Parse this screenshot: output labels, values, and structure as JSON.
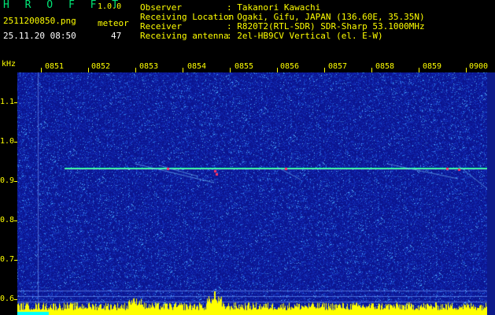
{
  "header": {
    "app_title": "H R O F F T",
    "version": "1.0.0",
    "filename": "2511200850.png",
    "date_time": "25.11.20 08:50",
    "meteor_label": "meteor",
    "meteor_count": "47"
  },
  "info": [
    {
      "label": "Observer",
      "value": ": Takanori Kawachi"
    },
    {
      "label": "Receiving Location",
      "value": ": Ogaki, Gifu, JAPAN (136.60E, 35.35N)"
    },
    {
      "label": "Receiver",
      "value": ": R820T2(RTL-SDR) SDR-Sharp 53.1000MHz"
    },
    {
      "label": "Receiving antenna",
      "value": ": 2el-HB9CV Vertical (el. E-W)"
    }
  ],
  "axis": {
    "unit": "kHz",
    "time_labels": [
      "0851",
      "0852",
      "0853",
      "0854",
      "0855",
      "0856",
      "0857",
      "0858",
      "0859",
      "0900"
    ],
    "freq_labels": [
      "1.1",
      "1.0",
      "0.9",
      "0.8",
      "0.7",
      "0.6"
    ]
  },
  "colors": {
    "background": "#0b1590",
    "signal": "#00ff88",
    "meteor_echo": "#ff3366",
    "bottom_bar": "#ffff00",
    "label": "#ffff00",
    "title": "#00e676"
  }
}
